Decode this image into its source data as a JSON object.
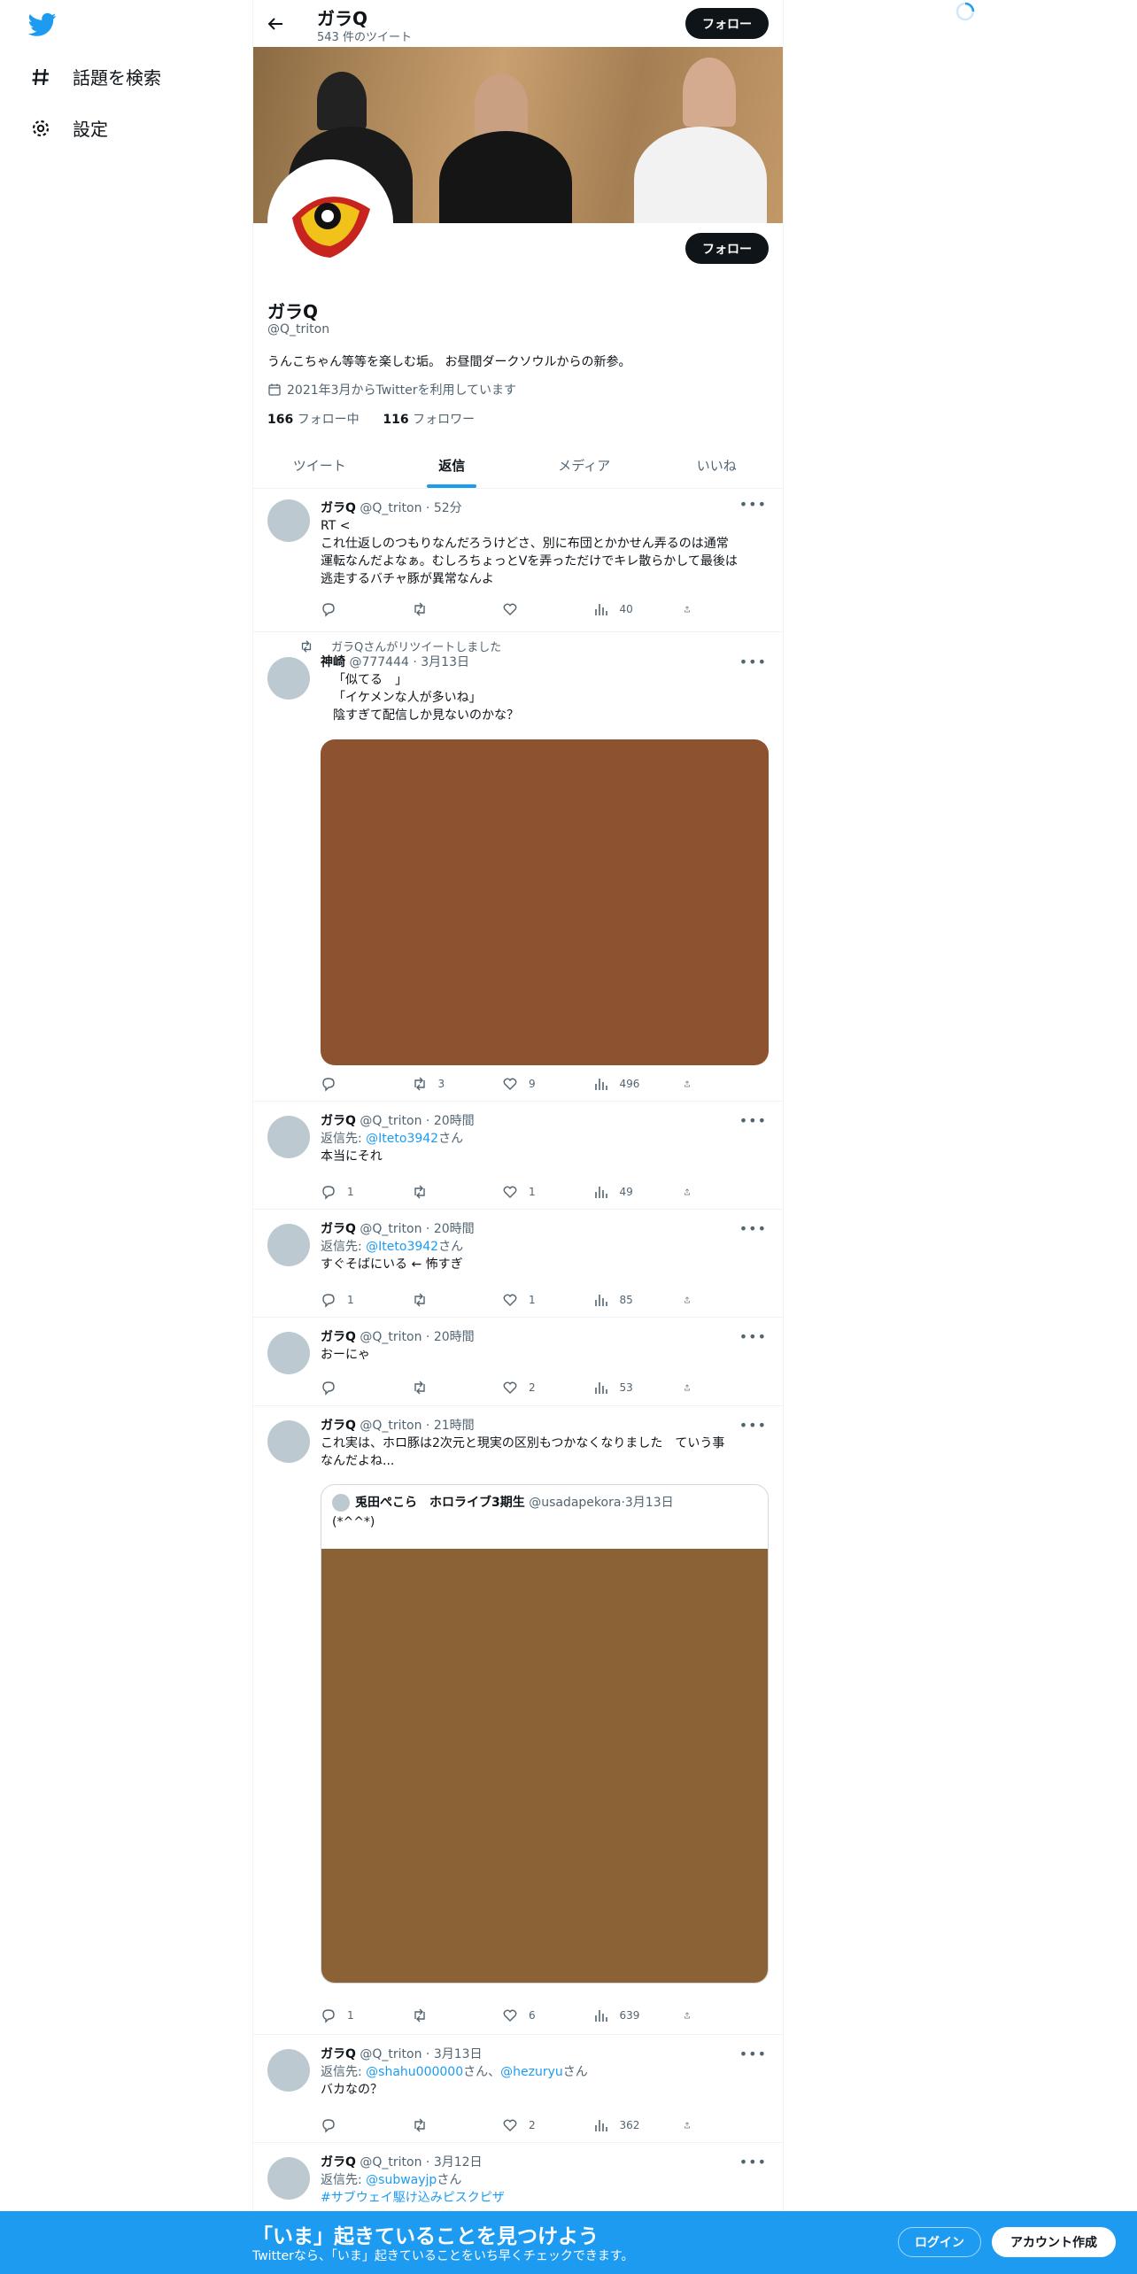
{
  "nav": {
    "explore_label": "話題を検索",
    "settings_label": "設定"
  },
  "header": {
    "name": "ガラQ",
    "tweet_count": "543 件のツイート",
    "follow_label": "フォロー"
  },
  "profile": {
    "name": "ガラQ",
    "handle": "@Q_triton",
    "bio": "うんこちゃん等等を楽しむ垢。 お昼間ダークソウルからの新参。",
    "joined": "2021年3月からTwitterを利用しています",
    "following_count": "166",
    "following_label": "フォロー中",
    "followers_count": "116",
    "followers_label": "フォロワー",
    "follow_label": "フォロー"
  },
  "tabs": [
    "ツイート",
    "返信",
    "メディア",
    "いいね"
  ],
  "tweets": [
    {
      "name": "ガラQ",
      "handle": "@Q_triton",
      "time": "52分",
      "text": "RT <\nこれ仕返しのつもりなんだろうけどさ、別に布団とかかせん弄るのは通常\n運転なんだよなぁ。むしろちょっとVを弄っただけでキレ散らかして最後は\n逃走するバチャ豚が異常なんよ",
      "replies": "",
      "retweets": "",
      "likes": "",
      "views": "40"
    },
    {
      "retweeted_by": "ガラQさんがリツイートしました",
      "name": "神崎",
      "handle": "@777444",
      "time": "3月13日",
      "text": "「似てる　」\n「イケメンな人が多いね」\n陰すぎて配信しか見ないのかな？",
      "replies": "",
      "retweets": "3",
      "likes": "9",
      "views": "496"
    },
    {
      "name": "ガラQ",
      "handle": "@Q_triton",
      "time": "20時間",
      "reply_to_prefix": "返信先: ",
      "reply_to": "@Iteto3942",
      "reply_to_suffix": "さん",
      "text": "本当にそれ",
      "replies": "1",
      "retweets": "",
      "likes": "1",
      "views": "49"
    },
    {
      "name": "ガラQ",
      "handle": "@Q_triton",
      "time": "20時間",
      "reply_to_prefix": "返信先: ",
      "reply_to": "@Iteto3942",
      "reply_to_suffix": "さん",
      "text": "すぐそばにいる ← 怖すぎ",
      "replies": "1",
      "retweets": "",
      "likes": "1",
      "views": "85"
    },
    {
      "name": "ガラQ",
      "handle": "@Q_triton",
      "time": "20時間",
      "text": "おーにゃ",
      "replies": "",
      "retweets": "",
      "likes": "2",
      "views": "53"
    },
    {
      "name": "ガラQ",
      "handle": "@Q_triton",
      "time": "21時間",
      "text": "これ実は、ホロ豚は2次元と現実の区別もつかなくなりました　ていう事\nなんだよね...",
      "quote": {
        "name": "兎田ぺこら　ホロライブ3期生",
        "handle": "@usadapekora",
        "time": "3月13日",
        "text": "(*^^*)"
      },
      "replies": "1",
      "retweets": "",
      "likes": "6",
      "views": "639"
    },
    {
      "name": "ガラQ",
      "handle": "@Q_triton",
      "time": "3月13日",
      "reply_to_prefix": "返信先: ",
      "reply_to": "@shahu000000",
      "reply_to_mid": "さん、",
      "reply_to2": "@hezuryu",
      "reply_to_suffix": "さん",
      "text": "バカなの？",
      "replies": "",
      "retweets": "",
      "likes": "2",
      "views": "362"
    },
    {
      "name": "ガラQ",
      "handle": "@Q_triton",
      "time": "3月12日",
      "reply_to_prefix": "返信先: ",
      "reply_to": "@subwayjp",
      "reply_to_suffix": "さん",
      "hashtag": "#サブウェイ駆け込みピスクピザ"
    }
  ],
  "bottom_bar": {
    "title": "「いま」起きていることを見つけよう",
    "subtitle": "Twitterなら、「いま」起きていることをいち早くチェックできます。",
    "login_label": "ログイン",
    "signup_label": "アカウント作成"
  },
  "colors": {
    "accent": "#1d9bf0",
    "media1": "#8d5330",
    "media2": "#8b6236"
  }
}
